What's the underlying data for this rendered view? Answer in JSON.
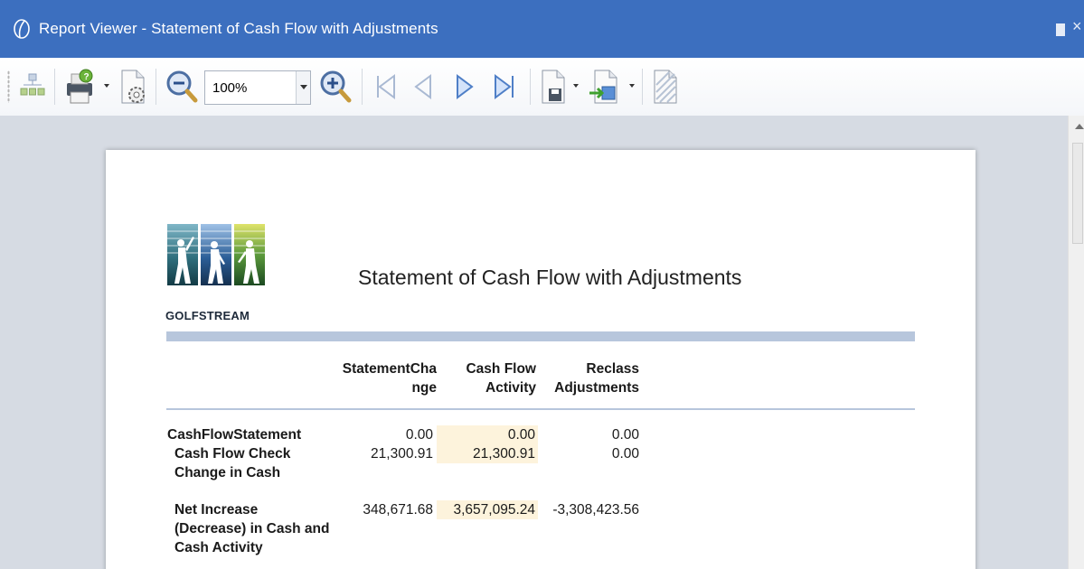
{
  "window": {
    "title": "Report Viewer - Statement of Cash Flow with Adjustments"
  },
  "toolbar": {
    "icons": [
      "document-map-icon",
      "print-icon",
      "page-setup-icon",
      "zoom-out-icon",
      "zoom-in-icon",
      "first-page-icon",
      "previous-page-icon",
      "next-page-icon",
      "last-page-icon",
      "save-icon",
      "export-icon",
      "watermark-icon"
    ],
    "zoom_value": "100%"
  },
  "report": {
    "logo_text": "GOLFSTREAM",
    "title": "Statement of Cash Flow with Adjustments",
    "columns": {
      "statement_change": [
        "StatementCha",
        "nge"
      ],
      "cash_flow_activity": [
        "Cash Flow",
        "Activity"
      ],
      "reclass_adjustments": [
        "Reclass",
        "Adjustments"
      ]
    },
    "rows": [
      {
        "label_lines": [
          "CashFlowStatement"
        ],
        "statement_change": "0.00",
        "cash_flow_activity": "0.00",
        "reclass_adjustments": "0.00"
      },
      {
        "label_lines": [
          "Cash Flow Check",
          "Change in Cash"
        ],
        "statement_change": "21,300.91",
        "cash_flow_activity": "21,300.91",
        "reclass_adjustments": "0.00"
      },
      {
        "label_lines": [
          "Net Increase",
          "(Decrease) in Cash and",
          "Cash Activity"
        ],
        "statement_change": "348,671.68",
        "cash_flow_activity": "3,657,095.24",
        "reclass_adjustments": "-3,308,423.56"
      }
    ]
  },
  "colors": {
    "titlebar": "#3c6fbf",
    "viewer_background": "#d6dbe3",
    "rule": "#b7c6dc",
    "highlight": "#fdf3dc"
  }
}
